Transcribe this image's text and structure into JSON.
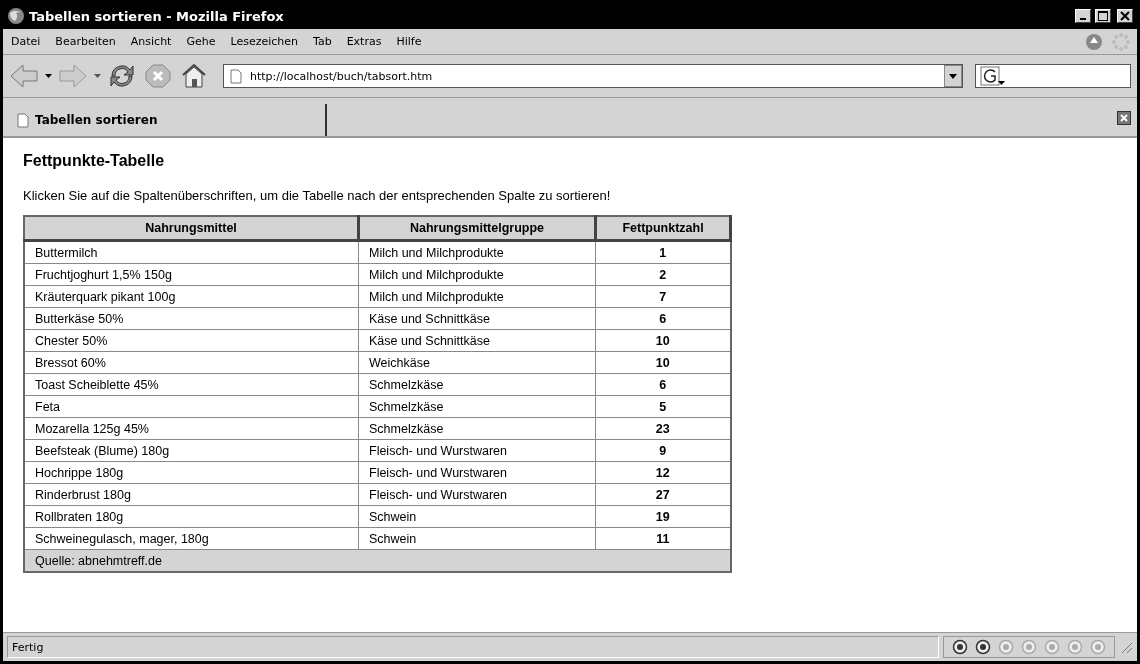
{
  "window": {
    "title": "Tabellen sortieren - Mozilla Firefox"
  },
  "menu": [
    "Datei",
    "Bearbeiten",
    "Ansicht",
    "Gehe",
    "Lesezeichen",
    "Tab",
    "Extras",
    "Hilfe"
  ],
  "address_bar": {
    "value": "http://localhost/buch/tabsort.htm"
  },
  "tabs": [
    {
      "label": "Tabellen sortieren",
      "selected": true
    }
  ],
  "page": {
    "heading": "Fettpunkte-Tabelle",
    "intro": "Klicken Sie auf die Spaltenüberschriften, um die Tabelle nach der entsprechenden Spalte zu sortieren!",
    "table": {
      "columns": [
        "Nahrungsmittel",
        "Nahrungsmittelgruppe",
        "Fettpunktzahl"
      ],
      "rows": [
        [
          "Buttermilch",
          "Milch und Milchprodukte",
          "1"
        ],
        [
          "Fruchtjoghurt 1,5% 150g",
          "Milch und Milchprodukte",
          "2"
        ],
        [
          "Kräuterquark pikant 100g",
          "Milch und Milchprodukte",
          "7"
        ],
        [
          "Butterkäse 50%",
          "Käse und Schnittkäse",
          "6"
        ],
        [
          "Chester 50%",
          "Käse und Schnittkäse",
          "10"
        ],
        [
          "Bressot 60%",
          "Weichkäse",
          "10"
        ],
        [
          "Toast Scheiblette 45%",
          "Schmelzkäse",
          "6"
        ],
        [
          "Feta",
          "Schmelzkäse",
          "5"
        ],
        [
          "Mozarella 125g 45%",
          "Schmelzkäse",
          "23"
        ],
        [
          "Beefsteak (Blume) 180g",
          "Fleisch- und Wurstwaren",
          "9"
        ],
        [
          "Hochrippe 180g",
          "Fleisch- und Wurstwaren",
          "12"
        ],
        [
          "Rinderbrust 180g",
          "Fleisch- und Wurstwaren",
          "27"
        ],
        [
          "Rollbraten 180g",
          "Schwein",
          "19"
        ],
        [
          "Schweinegulasch, mager, 180g",
          "Schwein",
          "11"
        ]
      ],
      "footer": "Quelle: abnehmtreff.de"
    }
  },
  "status_bar": {
    "text": "Fertig",
    "buttons": [
      {
        "disabled": false
      },
      {
        "disabled": false
      },
      {
        "disabled": true
      },
      {
        "disabled": true
      },
      {
        "disabled": true
      },
      {
        "disabled": true
      },
      {
        "disabled": true
      }
    ]
  }
}
